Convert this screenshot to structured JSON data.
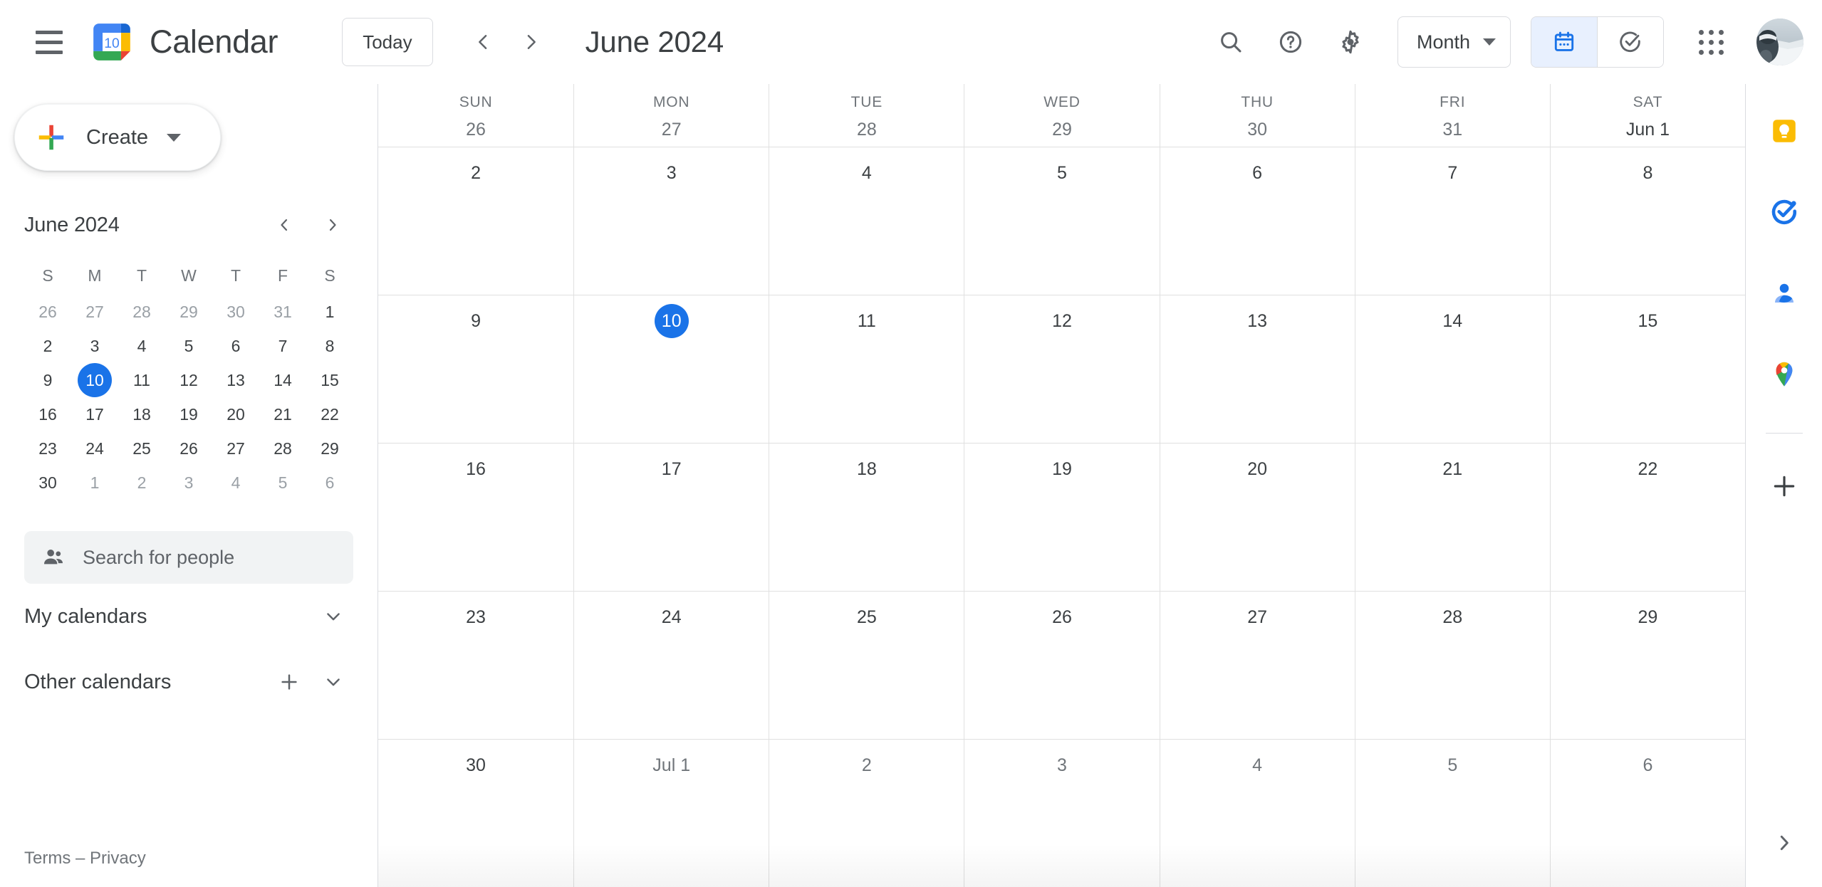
{
  "app": {
    "brand": "Calendar",
    "logo_day": "10"
  },
  "toolbar": {
    "menu_icon": "hamburger-menu-icon",
    "today_label": "Today",
    "prev_label": "‹",
    "next_label": "›",
    "period_title": "June 2024",
    "search_icon": "search-icon",
    "help_icon": "help-icon",
    "settings_icon": "settings-gear-icon",
    "view_label": "Month",
    "calendar_toggle_icon": "calendar-icon",
    "tasks_toggle_icon": "tasks-check-icon",
    "apps_icon": "apps-grid-icon",
    "avatar_icon": "user-avatar"
  },
  "sidebar": {
    "create_label": "Create",
    "create_icon": "google-plus-icon",
    "mini_calendar": {
      "title": "June 2024",
      "prev_icon": "chevron-left-icon",
      "next_icon": "chevron-right-icon",
      "dow": [
        "S",
        "M",
        "T",
        "W",
        "T",
        "F",
        "S"
      ],
      "weeks": [
        [
          {
            "n": "26",
            "out": true
          },
          {
            "n": "27",
            "out": true
          },
          {
            "n": "28",
            "out": true
          },
          {
            "n": "29",
            "out": true
          },
          {
            "n": "30",
            "out": true
          },
          {
            "n": "31",
            "out": true
          },
          {
            "n": "1",
            "out": false
          }
        ],
        [
          {
            "n": "2"
          },
          {
            "n": "3"
          },
          {
            "n": "4"
          },
          {
            "n": "5"
          },
          {
            "n": "6"
          },
          {
            "n": "7"
          },
          {
            "n": "8"
          }
        ],
        [
          {
            "n": "9"
          },
          {
            "n": "10",
            "today": true
          },
          {
            "n": "11"
          },
          {
            "n": "12"
          },
          {
            "n": "13"
          },
          {
            "n": "14"
          },
          {
            "n": "15"
          }
        ],
        [
          {
            "n": "16"
          },
          {
            "n": "17"
          },
          {
            "n": "18"
          },
          {
            "n": "19"
          },
          {
            "n": "20"
          },
          {
            "n": "21"
          },
          {
            "n": "22"
          }
        ],
        [
          {
            "n": "23"
          },
          {
            "n": "24"
          },
          {
            "n": "25"
          },
          {
            "n": "26"
          },
          {
            "n": "27"
          },
          {
            "n": "28"
          },
          {
            "n": "29"
          }
        ],
        [
          {
            "n": "30"
          },
          {
            "n": "1",
            "out": true
          },
          {
            "n": "2",
            "out": true
          },
          {
            "n": "3",
            "out": true
          },
          {
            "n": "4",
            "out": true
          },
          {
            "n": "5",
            "out": true
          },
          {
            "n": "6",
            "out": true
          }
        ]
      ]
    },
    "people_search": {
      "placeholder": "Search for people",
      "icon": "people-icon"
    },
    "sections": [
      {
        "label": "My calendars",
        "has_add": false,
        "expand_icon": "chevron-down-icon"
      },
      {
        "label": "Other calendars",
        "has_add": true,
        "add_icon": "plus-icon",
        "expand_icon": "chevron-down-icon"
      }
    ],
    "footer": "Terms – Privacy"
  },
  "calendar_grid": {
    "day_names": [
      "SUN",
      "MON",
      "TUE",
      "WED",
      "THU",
      "FRI",
      "SAT"
    ],
    "weeks": [
      [
        {
          "n": "26",
          "out": true
        },
        {
          "n": "27",
          "out": true
        },
        {
          "n": "28",
          "out": true
        },
        {
          "n": "29",
          "out": true
        },
        {
          "n": "30",
          "out": true
        },
        {
          "n": "31",
          "out": true
        },
        {
          "n": "Jun 1",
          "out": false
        }
      ],
      [
        {
          "n": "2"
        },
        {
          "n": "3"
        },
        {
          "n": "4"
        },
        {
          "n": "5"
        },
        {
          "n": "6"
        },
        {
          "n": "7"
        },
        {
          "n": "8"
        }
      ],
      [
        {
          "n": "9"
        },
        {
          "n": "10",
          "today": true
        },
        {
          "n": "11"
        },
        {
          "n": "12"
        },
        {
          "n": "13"
        },
        {
          "n": "14"
        },
        {
          "n": "15"
        }
      ],
      [
        {
          "n": "16"
        },
        {
          "n": "17"
        },
        {
          "n": "18"
        },
        {
          "n": "19"
        },
        {
          "n": "20"
        },
        {
          "n": "21"
        },
        {
          "n": "22"
        }
      ],
      [
        {
          "n": "23"
        },
        {
          "n": "24"
        },
        {
          "n": "25"
        },
        {
          "n": "26"
        },
        {
          "n": "27"
        },
        {
          "n": "28"
        },
        {
          "n": "29"
        }
      ],
      [
        {
          "n": "30"
        },
        {
          "n": "Jul 1",
          "out": true
        },
        {
          "n": "2",
          "out": true
        },
        {
          "n": "3",
          "out": true
        },
        {
          "n": "4",
          "out": true
        },
        {
          "n": "5",
          "out": true
        },
        {
          "n": "6",
          "out": true
        }
      ]
    ]
  },
  "right_rail": {
    "items": [
      {
        "icon": "google-keep-icon"
      },
      {
        "icon": "google-tasks-icon"
      },
      {
        "icon": "google-contacts-icon"
      },
      {
        "icon": "google-maps-icon"
      }
    ],
    "add_icon": "plus-icon",
    "expand_icon": "chevron-right-icon"
  },
  "colors": {
    "accent_blue": "#1a73e8",
    "toggle_active_bg": "#e8f0fe",
    "text_primary": "#3c4043",
    "text_secondary": "#70757a",
    "border": "#dadce0",
    "grid_line": "#e0e0e0",
    "google_red": "#ea4335",
    "google_yellow": "#fbbc04",
    "google_green": "#34a853",
    "google_blue": "#4285f4"
  }
}
